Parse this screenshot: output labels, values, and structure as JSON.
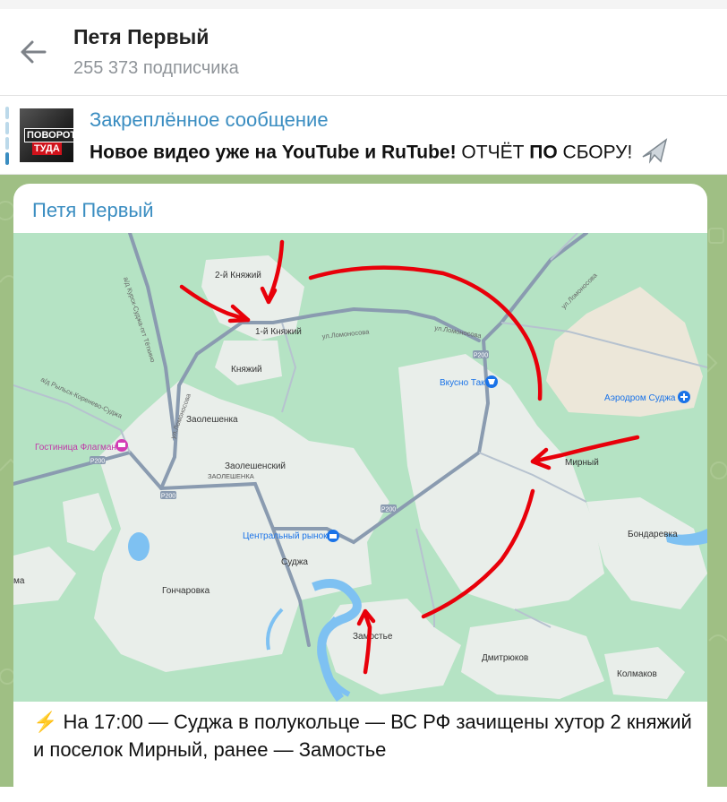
{
  "header": {
    "title": "Петя Первый",
    "subscribers": "255 373 подписчика"
  },
  "pinned": {
    "label": "Закреплённое сообщение",
    "thumb_top": "ПОВОРОТ",
    "thumb_bottom": "ТУДА",
    "text_bold": "Новое видео уже на YouTube и RuTube!",
    "text_normal1": " ОТЧЁТ ",
    "text_bold2": "ПО",
    "text_normal2": " СБОРУ!"
  },
  "message": {
    "sender": "Петя Первый",
    "caption_icon": "⚡",
    "caption_text": "На 17:00 — Суджа в полукольце — ВС РФ зачищены хутор 2 княжий и поселок Мирный, ранее — Замостье"
  },
  "map": {
    "labels": {
      "knyazhiy2": "2-й Княжий",
      "knyazhiy1": "1-й Княжий",
      "knyazhiy": "Княжий",
      "lomonosova1": "ул.Ломоносова",
      "lomonosova2": "ул.Ломоносова",
      "lomonosova3": "ул.Ломоносова",
      "lomonosova4": "ул.Ломоносова",
      "zaoleshenka": "Заолешенка",
      "zaoleshenskiy": "Заолешенский",
      "zaoleshenka_caps": "ЗАОЛЕШЕНКА",
      "hotel": "Гостиница Флагман",
      "p200a": "Р200",
      "p200b": "Р200",
      "p200c": "Р200",
      "p200d": "Р200",
      "vkusno": "Вкусно Так",
      "airport": "Аэродром Суджа",
      "mirnyy": "Мирный",
      "central_market": "Центральный рынок",
      "sudzha": "Суджа",
      "goncharovka": "Гончаровка",
      "zamostye": "Замостье",
      "bondarevka": "Бондаревка",
      "dmitryukov": "Дмитрюков",
      "kolmakov": "Колмаков",
      "road_ryl": "а/д Рыльск-Коренево-Суджа",
      "road_kursk": "а/д Курск-Суджа-пгт Тёткино",
      "edge_ma": "ма"
    },
    "colors": {
      "land": "#e9eeea",
      "forest": "#b5e3c4",
      "water": "#7ec1f2",
      "road": "#8a9bb0",
      "arrow": "#e8000a",
      "airfield": "#ece7d9",
      "poi_blue": "#1a73e8",
      "poi_pink": "#d33cb5"
    }
  }
}
